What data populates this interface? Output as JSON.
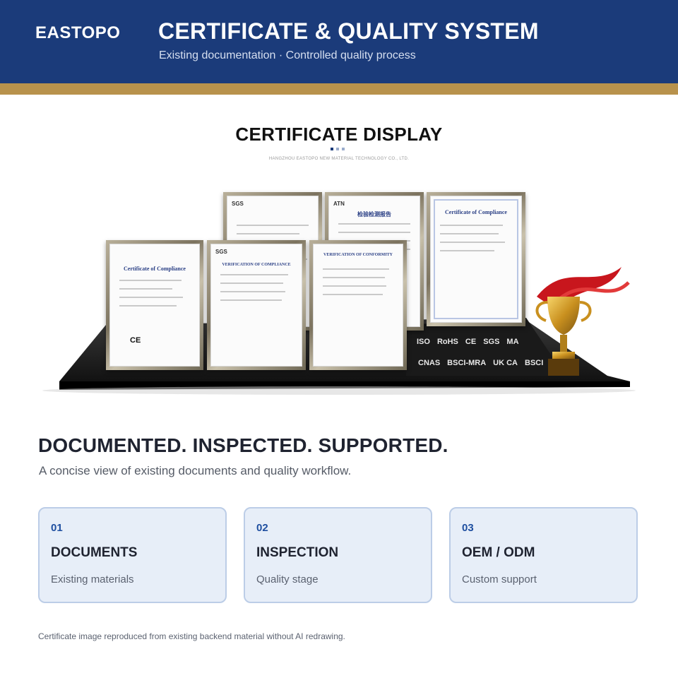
{
  "header": {
    "brand": "EASTOPO",
    "title": "CERTIFICATE & QUALITY SYSTEM",
    "subtitle": "Existing documentation · Controlled quality process"
  },
  "display": {
    "title": "CERTIFICATE DISPLAY",
    "company": "HANGZHOU EASTOPO NEW MATERIAL TECHNOLOGY CO., LTD.",
    "certificates": [
      {
        "header": "SGS",
        "title": ""
      },
      {
        "header": "ATN",
        "title": "检验检测报告"
      },
      {
        "header": "",
        "title": "Certificate of Compliance"
      },
      {
        "header": "",
        "title": "Certificate of Compliance",
        "mark": "CE"
      },
      {
        "header": "SGS",
        "title": "VERIFICATION OF COMPLIANCE"
      },
      {
        "header": "",
        "title": "VERIFICATION OF CONFORMITY"
      }
    ],
    "logos": [
      "ISO",
      "RoHS",
      "CE",
      "SGS",
      "MA",
      "CNAS",
      "BSCI-MRA",
      "UK CA",
      "BSCI"
    ]
  },
  "section": {
    "title": "DOCUMENTED. INSPECTED. SUPPORTED.",
    "subtitle": "A concise view of existing documents and quality workflow."
  },
  "cards": [
    {
      "num": "01",
      "title": "DOCUMENTS",
      "desc": "Existing materials"
    },
    {
      "num": "02",
      "title": "INSPECTION",
      "desc": "Quality stage"
    },
    {
      "num": "03",
      "title": "OEM / ODM",
      "desc": "Custom support"
    }
  ],
  "footnote": "Certificate image reproduced from existing backend material without AI redrawing.",
  "colors": {
    "header_bg": "#1b3b7a",
    "gold": "#b8924c",
    "card_bg": "#e7eef8",
    "card_border": "#bccde7",
    "accent": "#1f4fa0"
  }
}
